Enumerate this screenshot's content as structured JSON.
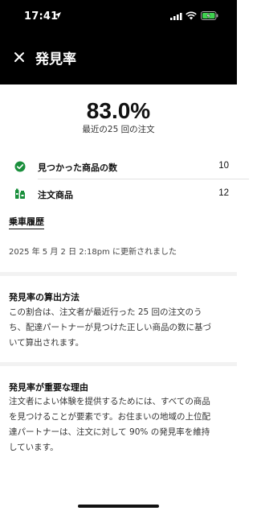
{
  "status_bar": {
    "time": "17:41"
  },
  "header": {
    "title": "発見率"
  },
  "summary": {
    "rate": "83.0%",
    "caption": "最近の25 回の注文"
  },
  "metrics": [
    {
      "label": "見つかった商品の数",
      "value": "10",
      "icon": "check-circle-icon",
      "color": "#1a8f3c"
    },
    {
      "label": "注文商品",
      "value": "12",
      "icon": "grocery-items-icon",
      "color": "#1a8f3c"
    }
  ],
  "history": {
    "link_label": "乗車履歴",
    "updated": "2025 年 5 月 2 日 2:18pm に更新されました"
  },
  "sections": [
    {
      "title": "発見率の算出方法",
      "lines": [
        "この割合は、注文者が最近行った 25 回の注文のう",
        "ち、配達パートナーが見つけた正しい商品の数に基づ",
        "いて算出されます。"
      ]
    },
    {
      "title": "発見率が重要な理由",
      "lines": [
        "注文者によい体験を提供するためには、すべての商品",
        "を見つけることが要素です。お住まいの地域の上位配",
        "達パートナーは、注文に対して 90% の発見率を維持",
        "しています。"
      ]
    }
  ]
}
